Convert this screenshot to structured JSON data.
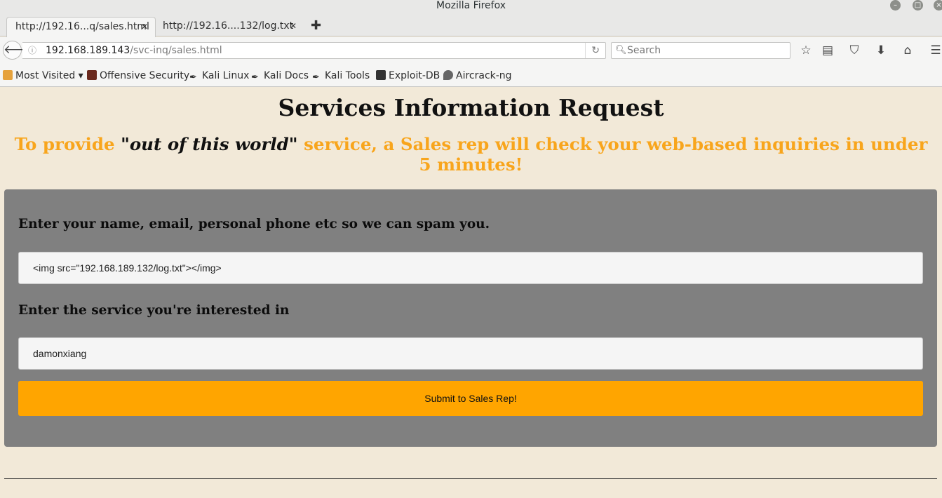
{
  "window": {
    "title": "Mozilla Firefox"
  },
  "tabs": [
    {
      "label": "http://192.16...q/sales.html",
      "active": true
    },
    {
      "label": "http://192.16....132/log.txt",
      "active": false
    }
  ],
  "toolbar": {
    "url_host": "192.168.189.143",
    "url_path": "/svc-inq/sales.html",
    "search_placeholder": "Search"
  },
  "bookmarks": [
    {
      "label": "Most Visited ▾",
      "icon": "folder-icon"
    },
    {
      "label": "Offensive Security",
      "icon": "offsec-icon"
    },
    {
      "label": "Kali Linux",
      "icon": "kali-dragon-icon"
    },
    {
      "label": "Kali Docs",
      "icon": "kali-dragon-icon"
    },
    {
      "label": "Kali Tools",
      "icon": "kali-dragon-icon"
    },
    {
      "label": "Exploit-DB",
      "icon": "exploit-db-icon"
    },
    {
      "label": "Aircrack-ng",
      "icon": "aircrack-icon"
    }
  ],
  "page": {
    "title": "Services Information Request",
    "subtitle_pre": "To provide ",
    "subtitle_quote_open": "\"",
    "subtitle_emph": "out of this world",
    "subtitle_quote_close": "\"",
    "subtitle_post": " service, a Sales rep will check your web-based inquiries in under 5 minutes!",
    "form": {
      "contact_label": "Enter your name, email, personal phone etc so we can spam you.",
      "contact_value": "<img src=\"192.168.189.132/log.txt\"></img>",
      "service_label": "Enter the service you're interested in",
      "service_value": "damonxiang",
      "submit_label": "Submit to Sales Rep!"
    }
  },
  "colors": {
    "page_bg": "#f2e9d8",
    "accent_orange": "#ffa500",
    "panel_gray": "#808080"
  }
}
